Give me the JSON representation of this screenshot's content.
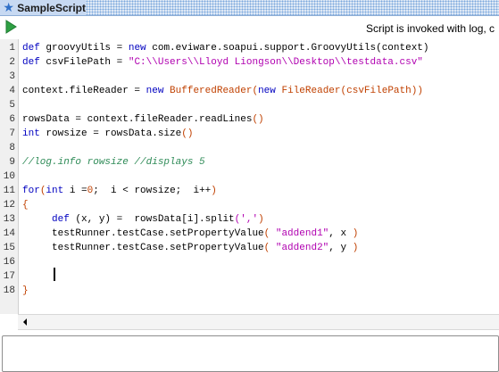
{
  "window": {
    "title": "SampleScript",
    "icon": "star-icon"
  },
  "toolbar": {
    "run_icon": "run-play-icon",
    "info_text": "Script is invoked with log, c"
  },
  "editor": {
    "line_numbers": [
      "1",
      "2",
      "3",
      "4",
      "5",
      "6",
      "7",
      "8",
      "9",
      "10",
      "11",
      "12",
      "13",
      "14",
      "15",
      "16",
      "17",
      "18"
    ],
    "lines": [
      [
        {
          "t": "def",
          "c": "kw"
        },
        {
          "t": " groovyUtils = "
        },
        {
          "t": "new",
          "c": "kw"
        },
        {
          "t": " com.eviware.soapui.support.GroovyUtils(context)"
        }
      ],
      [
        {
          "t": "def",
          "c": "kw"
        },
        {
          "t": " csvFilePath = "
        },
        {
          "t": "\"C:\\\\Users\\\\Lloyd Liongson\\\\Desktop\\\\testdata.csv\"",
          "c": "str"
        }
      ],
      [],
      [
        {
          "t": "context.fileReader = "
        },
        {
          "t": "new",
          "c": "kw"
        },
        {
          "t": " "
        },
        {
          "t": "BufferedReader(",
          "c": "cls"
        },
        {
          "t": "new",
          "c": "kw"
        },
        {
          "t": " "
        },
        {
          "t": "FileReader(csvFilePath))",
          "c": "cls"
        }
      ],
      [],
      [
        {
          "t": "rowsData = context.fileReader.readLines"
        },
        {
          "t": "()",
          "c": "cls"
        }
      ],
      [
        {
          "t": "int",
          "c": "kw"
        },
        {
          "t": " rowsize = rowsData.size"
        },
        {
          "t": "()",
          "c": "cls"
        }
      ],
      [],
      [
        {
          "t": "//log.info rowsize //displays 5",
          "c": "cm"
        }
      ],
      [],
      [
        {
          "t": "for",
          "c": "kw"
        },
        {
          "t": "(",
          "c": "cls"
        },
        {
          "t": "int",
          "c": "kw"
        },
        {
          "t": " i ="
        },
        {
          "t": "0",
          "c": "cls"
        },
        {
          "t": ";  i < rowsize;  i++"
        },
        {
          "t": ")",
          "c": "cls"
        }
      ],
      [
        {
          "t": "{",
          "c": "cls"
        }
      ],
      [
        {
          "t": "     "
        },
        {
          "t": "def",
          "c": "kw"
        },
        {
          "t": " (x, y) =  rowsData[i].split"
        },
        {
          "t": "(','",
          "c": "str"
        },
        {
          "t": ")",
          "c": "cls"
        }
      ],
      [
        {
          "t": "     testRunner.testCase.setPropertyValue"
        },
        {
          "t": "( ",
          "c": "cls"
        },
        {
          "t": "\"addend1\"",
          "c": "str"
        },
        {
          "t": ", x "
        },
        {
          "t": ")",
          "c": "cls"
        }
      ],
      [
        {
          "t": "     testRunner.testCase.setPropertyValue"
        },
        {
          "t": "( ",
          "c": "cls"
        },
        {
          "t": "\"addend2\"",
          "c": "str"
        },
        {
          "t": ", y "
        },
        {
          "t": ")",
          "c": "cls"
        }
      ],
      [],
      [],
      [
        {
          "t": "}",
          "c": "cls"
        }
      ]
    ]
  },
  "log_panel": {
    "text": ""
  }
}
